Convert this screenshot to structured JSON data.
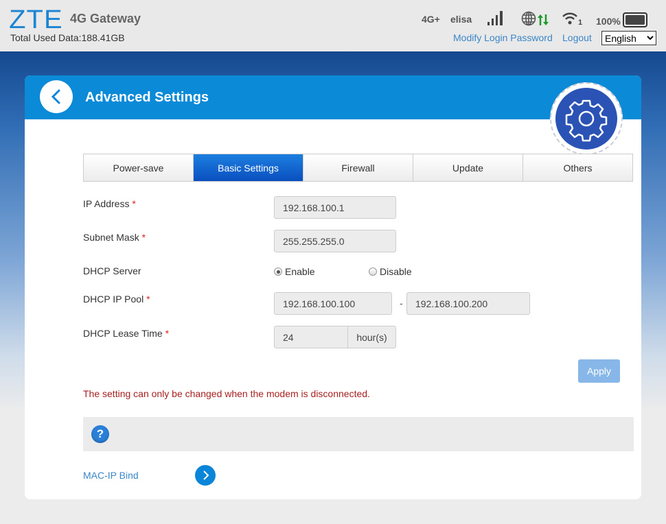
{
  "header": {
    "logo": "ZTE",
    "product": "4G Gateway",
    "used_data": "Total Used Data:188.41GB",
    "network_type": "4G+",
    "operator": "elisa",
    "wifi_clients": "1",
    "battery": "100%",
    "modify_password": "Modify Login Password",
    "logout": "Logout",
    "language": "English",
    "icons": [
      "signal-bars-icon",
      "globe-icon",
      "data-transfer-icon",
      "wifi-icon",
      "battery-icon"
    ],
    "transfer_color": "#1a9a2a"
  },
  "card": {
    "title": "Advanced Settings",
    "accent": "#0b8ad7"
  },
  "tabs": [
    {
      "label": "Power-save"
    },
    {
      "label": "Basic Settings",
      "active": true
    },
    {
      "label": "Firewall"
    },
    {
      "label": "Update"
    },
    {
      "label": "Others"
    }
  ],
  "form": {
    "ip_label": "IP Address",
    "ip_value": "192.168.100.1",
    "mask_label": "Subnet Mask",
    "mask_value": "255.255.255.0",
    "dhcp_label": "DHCP Server",
    "enable": "Enable",
    "disable": "Disable",
    "dhcp_selected": "Enable",
    "pool_label": "DHCP IP Pool",
    "pool_start": "192.168.100.100",
    "pool_sep": "-",
    "pool_end": "192.168.100.200",
    "lease_label": "DHCP Lease Time",
    "lease_value": "24",
    "lease_unit": "hour(s)",
    "required": "*"
  },
  "apply": "Apply",
  "warning": "The setting can only be changed when the modem is disconnected.",
  "help_icon": "?",
  "mac_ip_bind": "MAC-IP Bind"
}
